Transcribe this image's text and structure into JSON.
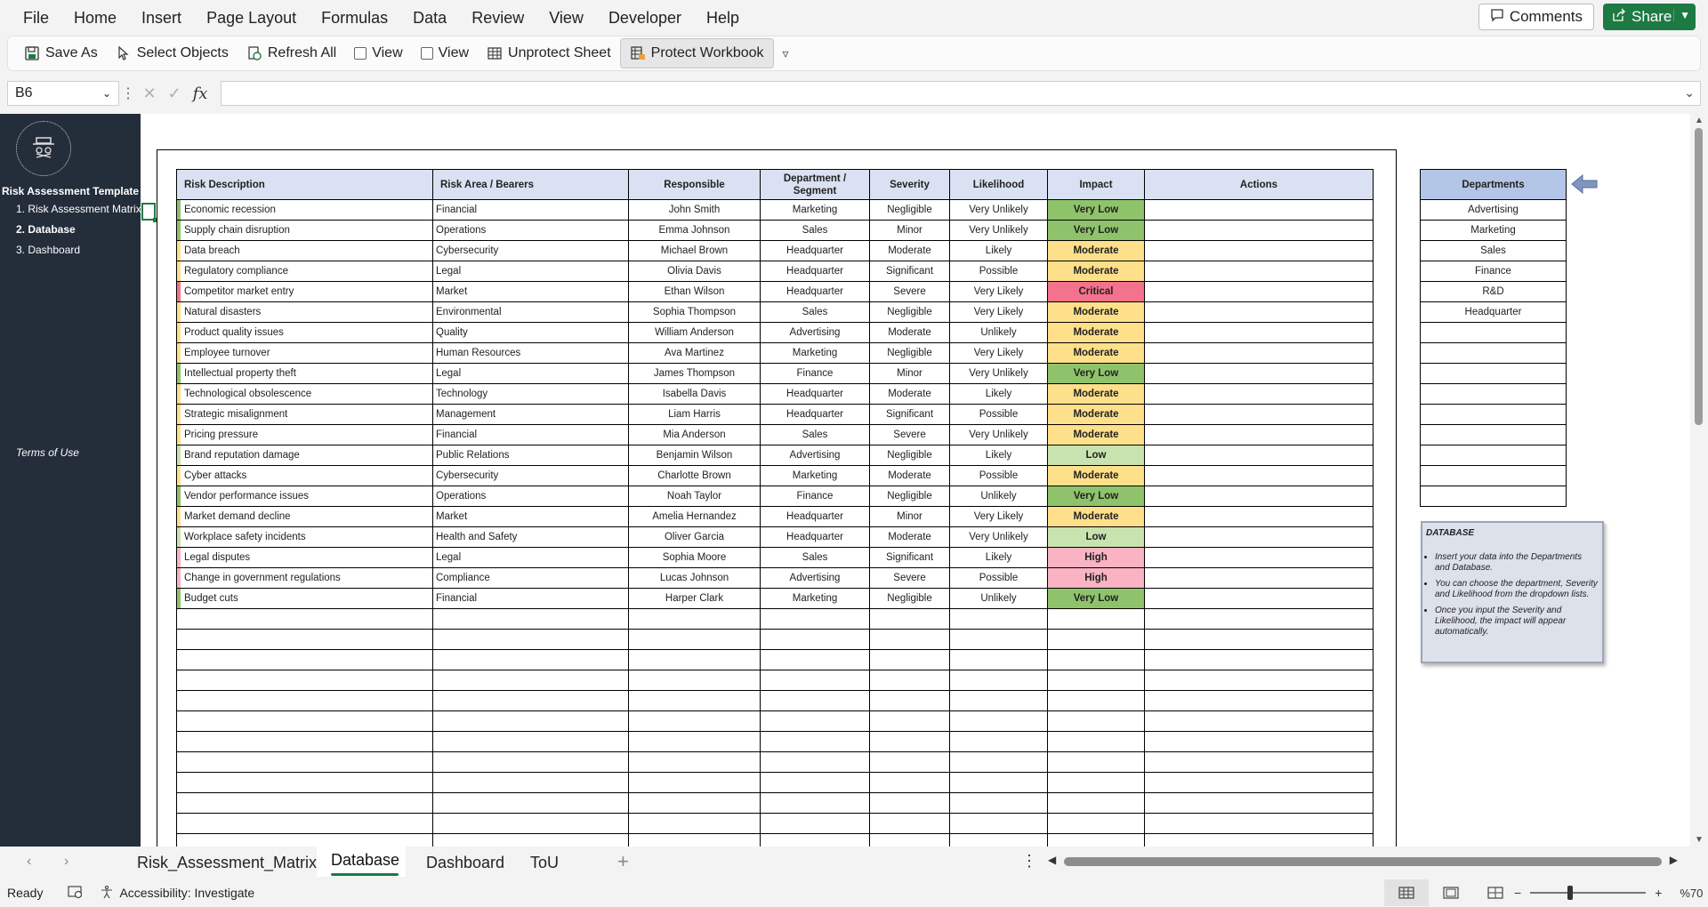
{
  "menu": [
    "File",
    "Home",
    "Insert",
    "Page Layout",
    "Formulas",
    "Data",
    "Review",
    "View",
    "Developer",
    "Help"
  ],
  "top_right": {
    "comments": "Comments",
    "share": "Share"
  },
  "ribbon": {
    "save_as": "Save As",
    "select_objects": "Select Objects",
    "refresh_all": "Refresh All",
    "view1": "View",
    "view2": "View",
    "unprotect_sheet": "Unprotect Sheet",
    "protect_workbook": "Protect Workbook"
  },
  "formula_bar": {
    "name_box": "B6",
    "fx": "fx",
    "value": ""
  },
  "sidebar": {
    "title": "Risk Assessment Template",
    "items": [
      {
        "label": "1. Risk Assessment Matrix"
      },
      {
        "label": "2. Database"
      },
      {
        "label": "3. Dashboard"
      }
    ],
    "terms": "Terms of Use"
  },
  "table": {
    "headers": [
      "Risk Description",
      "Risk Area / Bearers",
      "Responsible",
      "Department / Segment",
      "Severity",
      "Likelihood",
      "Impact",
      "Actions"
    ],
    "rows": [
      {
        "desc": "Economic recession",
        "area": "Financial",
        "resp": "John Smith",
        "dept": "Marketing",
        "sev": "Negligible",
        "lik": "Very Unlikely",
        "imp": "Very Low"
      },
      {
        "desc": "Supply chain disruption",
        "area": "Operations",
        "resp": "Emma Johnson",
        "dept": "Sales",
        "sev": "Minor",
        "lik": "Very Unlikely",
        "imp": "Very Low"
      },
      {
        "desc": "Data breach",
        "area": "Cybersecurity",
        "resp": "Michael Brown",
        "dept": "Headquarter",
        "sev": "Moderate",
        "lik": "Likely",
        "imp": "Moderate"
      },
      {
        "desc": "Regulatory compliance",
        "area": "Legal",
        "resp": "Olivia Davis",
        "dept": "Headquarter",
        "sev": "Significant",
        "lik": "Possible",
        "imp": "Moderate"
      },
      {
        "desc": "Competitor market entry",
        "area": "Market",
        "resp": "Ethan Wilson",
        "dept": "Headquarter",
        "sev": "Severe",
        "lik": "Very Likely",
        "imp": "Critical"
      },
      {
        "desc": "Natural disasters",
        "area": "Environmental",
        "resp": "Sophia Thompson",
        "dept": "Sales",
        "sev": "Negligible",
        "lik": "Very Likely",
        "imp": "Moderate"
      },
      {
        "desc": "Product quality issues",
        "area": "Quality",
        "resp": "William Anderson",
        "dept": "Advertising",
        "sev": "Moderate",
        "lik": "Unlikely",
        "imp": "Moderate"
      },
      {
        "desc": "Employee turnover",
        "area": "Human Resources",
        "resp": "Ava Martinez",
        "dept": "Marketing",
        "sev": "Negligible",
        "lik": "Very Likely",
        "imp": "Moderate"
      },
      {
        "desc": "Intellectual property theft",
        "area": "Legal",
        "resp": "James Thompson",
        "dept": "Finance",
        "sev": "Minor",
        "lik": "Very Unlikely",
        "imp": "Very Low"
      },
      {
        "desc": "Technological obsolescence",
        "area": "Technology",
        "resp": "Isabella Davis",
        "dept": "Headquarter",
        "sev": "Moderate",
        "lik": "Likely",
        "imp": "Moderate"
      },
      {
        "desc": "Strategic misalignment",
        "area": "Management",
        "resp": "Liam Harris",
        "dept": "Headquarter",
        "sev": "Significant",
        "lik": "Possible",
        "imp": "Moderate"
      },
      {
        "desc": "Pricing pressure",
        "area": "Financial",
        "resp": "Mia Anderson",
        "dept": "Sales",
        "sev": "Severe",
        "lik": "Very Unlikely",
        "imp": "Moderate"
      },
      {
        "desc": "Brand reputation damage",
        "area": "Public Relations",
        "resp": "Benjamin Wilson",
        "dept": "Advertising",
        "sev": "Negligible",
        "lik": "Likely",
        "imp": "Low"
      },
      {
        "desc": "Cyber attacks",
        "area": "Cybersecurity",
        "resp": "Charlotte Brown",
        "dept": "Marketing",
        "sev": "Moderate",
        "lik": "Possible",
        "imp": "Moderate"
      },
      {
        "desc": "Vendor performance issues",
        "area": "Operations",
        "resp": "Noah Taylor",
        "dept": "Finance",
        "sev": "Negligible",
        "lik": "Unlikely",
        "imp": "Very Low"
      },
      {
        "desc": "Market demand decline",
        "area": "Market",
        "resp": "Amelia Hernandez",
        "dept": "Headquarter",
        "sev": "Minor",
        "lik": "Very Likely",
        "imp": "Moderate"
      },
      {
        "desc": "Workplace safety incidents",
        "area": "Health and Safety",
        "resp": "Oliver Garcia",
        "dept": "Headquarter",
        "sev": "Moderate",
        "lik": "Very Unlikely",
        "imp": "Low"
      },
      {
        "desc": "Legal disputes",
        "area": "Legal",
        "resp": "Sophia Moore",
        "dept": "Sales",
        "sev": "Significant",
        "lik": "Likely",
        "imp": "High"
      },
      {
        "desc": "Change in government regulations",
        "area": "Compliance",
        "resp": "Lucas Johnson",
        "dept": "Advertising",
        "sev": "Severe",
        "lik": "Possible",
        "imp": "High"
      },
      {
        "desc": "Budget cuts",
        "area": "Financial",
        "resp": "Harper Clark",
        "dept": "Marketing",
        "sev": "Negligible",
        "lik": "Unlikely",
        "imp": "Very Low"
      }
    ],
    "empty_rows": 12
  },
  "impact_colors": {
    "Very Low": "#8fc36b",
    "Low": "#c8e3b0",
    "Moderate": "#ffe08a",
    "High": "#f9b3c2",
    "Critical": "#f3728c"
  },
  "departments": {
    "header": "Departments",
    "items": [
      "Advertising",
      "Marketing",
      "Sales",
      "Finance",
      "R&D",
      "Headquarter"
    ],
    "empty_rows": 9
  },
  "note": {
    "title": "DATABASE",
    "bullets": [
      "Insert your data into the Departments and Database.",
      "You can choose the department, Severity and Likelihood from the dropdown lists.",
      "Once you input the Severity and Likelihood, the impact will appear automatically."
    ]
  },
  "tabs": [
    {
      "label": "Risk_Assessment_Matrix",
      "active": false
    },
    {
      "label": "Database",
      "active": true
    },
    {
      "label": "Dashboard",
      "active": false
    },
    {
      "label": "ToU",
      "active": false
    }
  ],
  "status": {
    "ready": "Ready",
    "accessibility": "Accessibility: Investigate",
    "zoom": "%70"
  },
  "icons": [
    "save-icon",
    "cursor-icon",
    "refresh-icon",
    "table-lock-icon",
    "comment-icon",
    "share-icon",
    "arrow-left-icon"
  ]
}
